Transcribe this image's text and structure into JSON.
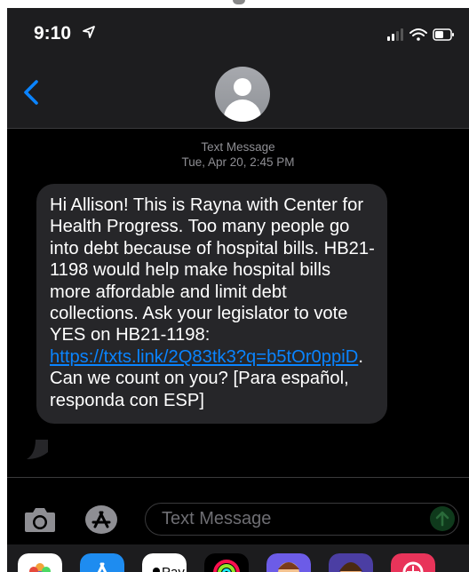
{
  "status_bar": {
    "time": "9:10"
  },
  "header": {
    "contact_avatar": "person-avatar"
  },
  "thread": {
    "service_label": "Text Message",
    "timestamp": "Tue, Apr 20, 2:45 PM",
    "message": {
      "text_before_link": "Hi Allison! This is Rayna with Center for Health Progress. Too many people go into debt because of hospital bills. HB21-1198 would help make hospital bills more affordable and limit debt collections.  Ask your legislator to vote YES on HB21-1198: ",
      "link_text": "https://txts.link/2Q83tk3?q=b5tOr0ppiD",
      "text_after_link": ". Can we count on you? [Para español, responda con ESP]"
    }
  },
  "compose": {
    "placeholder": "Text Message",
    "send_icon": "arrow-up-icon"
  },
  "app_strip": {
    "applepay_label": "Pay",
    "icons": [
      "photos-icon",
      "appstore-icon",
      "applepay-icon",
      "activity-icon",
      "memoji-icon",
      "memoji-icon-2",
      "search-images-icon"
    ]
  },
  "colors": {
    "background": "#000000",
    "bubble": "#262629",
    "link": "#0a84ff",
    "accent_blue": "#0a84ff",
    "meta_gray": "#8e8e93"
  }
}
